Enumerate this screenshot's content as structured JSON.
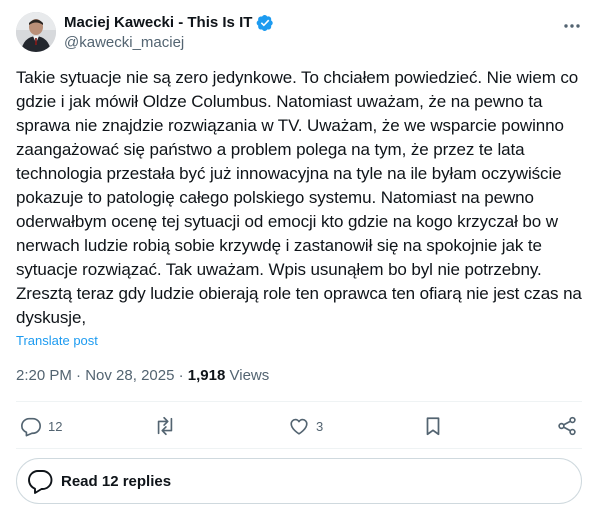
{
  "author": {
    "name": "Maciej Kawecki - This Is IT",
    "handle": "@kawecki_maciej",
    "verified": true
  },
  "post": {
    "text": "Takie sytuacje nie są zero jedynkowe. To chciałem powiedzieć. Nie wiem co gdzie i jak mówił Oldze Columbus. Natomiast uważam, że na pewno ta sprawa nie znajdzie rozwiązania w TV. Uważam, że we wsparcie powinno zaangażować się państwo a problem polega na tym, że przez te lata technologia przestała być już innowacyjna na tyle na ile byłam oczywiście pokazuje to patologię całego polskiego systemu. Natomiast na pewno oderwałbym ocenę tej sytuacji od emocji kto gdzie na kogo krzyczał bo w nerwach ludzie robią sobie krzywdę i zastanowił się na spokojnie jak te sytuacje rozwiązać. Tak uważam. Wpis usunąłem bo byl nie potrzebny. Zresztą teraz gdy ludzie obierają role ten oprawca ten ofiarą nie jest czas na dyskusje,",
    "translate_label": "Translate post"
  },
  "meta": {
    "time": "2:20 PM",
    "sep1": " · ",
    "date": "Nov 28, 2025",
    "sep2": " · ",
    "views_count": "1,918",
    "views_label": " Views"
  },
  "actions": {
    "reply_count": "12",
    "repost_count": "",
    "like_count": "3"
  },
  "read_replies_label": "Read 12 replies",
  "colors": {
    "accent": "#1d9bf0",
    "text": "#0f1419",
    "muted": "#536471",
    "divider": "#eff3f4"
  },
  "icons": [
    "verified-badge-icon",
    "more-icon",
    "reply-icon",
    "repost-icon",
    "like-icon",
    "bookmark-icon",
    "share-icon",
    "replies-bubble-icon"
  ]
}
